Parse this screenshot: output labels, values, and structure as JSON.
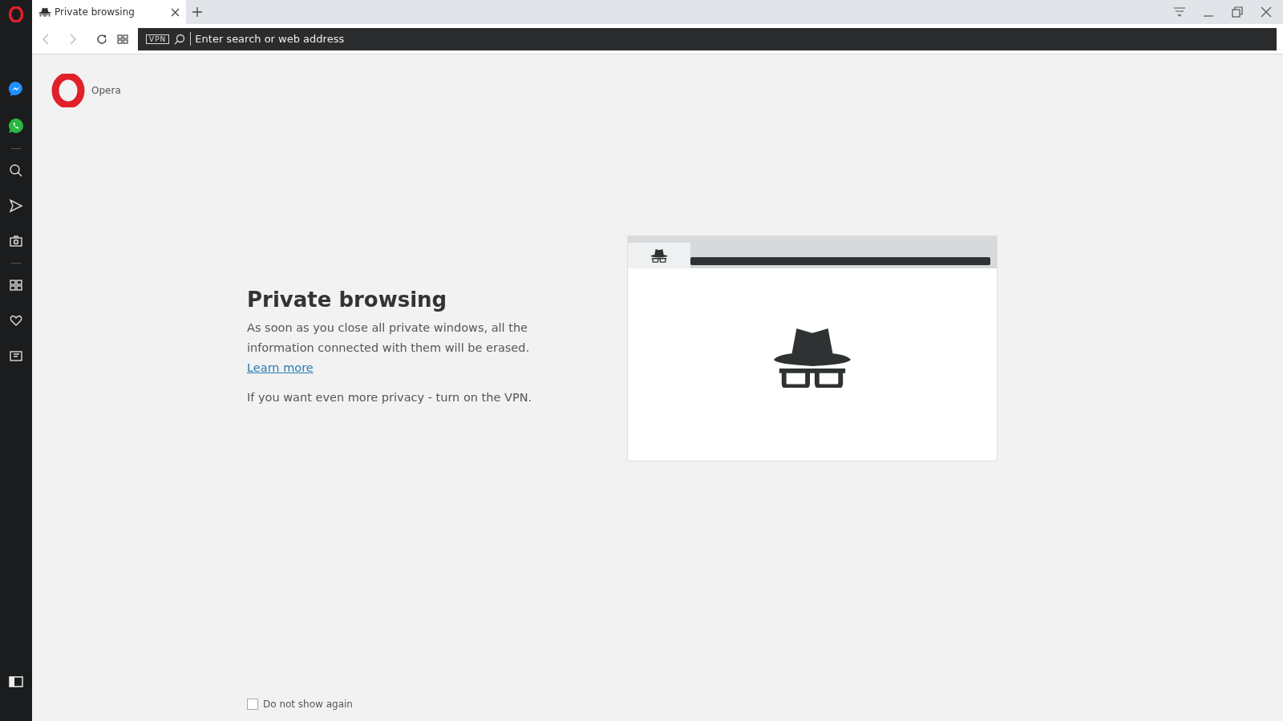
{
  "tabs": [
    {
      "label": "Private browsing",
      "selected": true
    }
  ],
  "address_bar": {
    "badge": "VPN",
    "placeholder": "Enter search or web address"
  },
  "logo_label": "Opera",
  "intro": {
    "title": "Private browsing",
    "body": "As soon as you close all private windows, all the information connected with them will be erased.",
    "link": "Learn more",
    "vpn_note": "If you want even more privacy - turn on the VPN."
  },
  "do_not_show_again": {
    "label": "Do not show again",
    "checked": false
  }
}
